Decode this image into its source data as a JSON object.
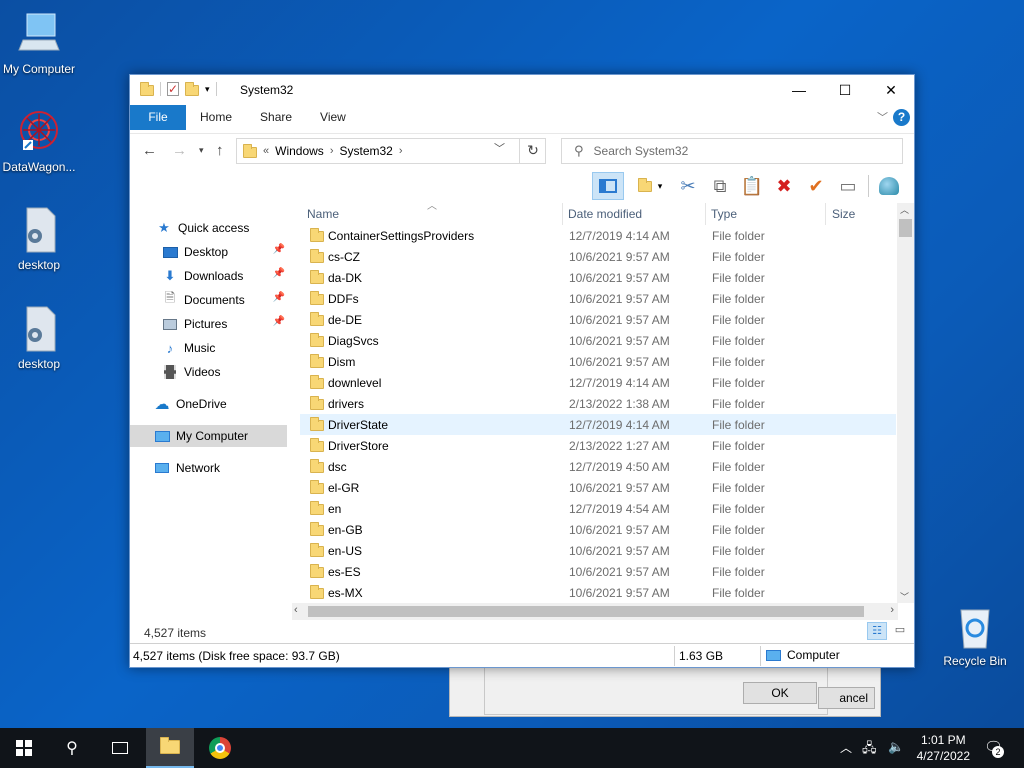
{
  "desktop": {
    "icons": [
      {
        "label": "My Computer",
        "icon": "computer-icon"
      },
      {
        "label": "DataWagon...",
        "icon": "datawagon-shortcut-icon"
      },
      {
        "label": "desktop",
        "icon": "settings-file-icon"
      },
      {
        "label": "desktop",
        "icon": "settings-file-icon"
      },
      {
        "label": "Recycle Bin",
        "icon": "recycle-bin-icon"
      }
    ]
  },
  "bg_dialog": {
    "ok_label": "OK",
    "cancel_label": "ancel"
  },
  "window": {
    "title": "System32",
    "controls": {
      "minimize": "—",
      "maximize": "☐",
      "close": "✕"
    },
    "ribbon_tabs": [
      "File",
      "Home",
      "Share",
      "View"
    ],
    "address": {
      "overflow": "«",
      "crumbs": [
        "Windows",
        "System32"
      ],
      "separator": "›"
    },
    "search": {
      "placeholder": "Search System32"
    },
    "columns": {
      "name": "Name",
      "date": "Date modified",
      "type": "Type",
      "size": "Size"
    },
    "nav": [
      {
        "label": "Quick access",
        "icon": "star-icon",
        "pinned": false
      },
      {
        "label": "Desktop",
        "icon": "desktop-icon",
        "pinned": true
      },
      {
        "label": "Downloads",
        "icon": "download-icon",
        "pinned": true
      },
      {
        "label": "Documents",
        "icon": "document-icon",
        "pinned": true
      },
      {
        "label": "Pictures",
        "icon": "picture-icon",
        "pinned": true
      },
      {
        "label": "Music",
        "icon": "music-icon",
        "pinned": false
      },
      {
        "label": "Videos",
        "icon": "video-icon",
        "pinned": false
      },
      {
        "label": "OneDrive",
        "icon": "cloud-icon",
        "pinned": false
      },
      {
        "label": "My Computer",
        "icon": "computer-icon",
        "pinned": false,
        "selected": true
      },
      {
        "label": "Network",
        "icon": "network-icon",
        "pinned": false
      }
    ],
    "files": [
      {
        "name": "ContainerSettingsProviders",
        "date": "12/7/2019 4:14 AM",
        "type": "File folder"
      },
      {
        "name": "cs-CZ",
        "date": "10/6/2021 9:57 AM",
        "type": "File folder"
      },
      {
        "name": "da-DK",
        "date": "10/6/2021 9:57 AM",
        "type": "File folder"
      },
      {
        "name": "DDFs",
        "date": "10/6/2021 9:57 AM",
        "type": "File folder"
      },
      {
        "name": "de-DE",
        "date": "10/6/2021 9:57 AM",
        "type": "File folder"
      },
      {
        "name": "DiagSvcs",
        "date": "10/6/2021 9:57 AM",
        "type": "File folder"
      },
      {
        "name": "Dism",
        "date": "10/6/2021 9:57 AM",
        "type": "File folder"
      },
      {
        "name": "downlevel",
        "date": "12/7/2019 4:14 AM",
        "type": "File folder"
      },
      {
        "name": "drivers",
        "date": "2/13/2022 1:38 AM",
        "type": "File folder"
      },
      {
        "name": "DriverState",
        "date": "12/7/2019 4:14 AM",
        "type": "File folder",
        "highlighted": true
      },
      {
        "name": "DriverStore",
        "date": "2/13/2022 1:27 AM",
        "type": "File folder"
      },
      {
        "name": "dsc",
        "date": "12/7/2019 4:50 AM",
        "type": "File folder"
      },
      {
        "name": "el-GR",
        "date": "10/6/2021 9:57 AM",
        "type": "File folder"
      },
      {
        "name": "en",
        "date": "12/7/2019 4:54 AM",
        "type": "File folder"
      },
      {
        "name": "en-GB",
        "date": "10/6/2021 9:57 AM",
        "type": "File folder"
      },
      {
        "name": "en-US",
        "date": "10/6/2021 9:57 AM",
        "type": "File folder"
      },
      {
        "name": "es-ES",
        "date": "10/6/2021 9:57 AM",
        "type": "File folder"
      },
      {
        "name": "es-MX",
        "date": "10/6/2021 9:57 AM",
        "type": "File folder"
      }
    ],
    "items_count": "4,527 items",
    "status": {
      "summary": "4,527 items (Disk free space: 93.7 GB)",
      "size": "1.63 GB",
      "location": "Computer"
    }
  },
  "taskbar": {
    "time": "1:01 PM",
    "date": "4/27/2022",
    "notification_count": "2"
  }
}
